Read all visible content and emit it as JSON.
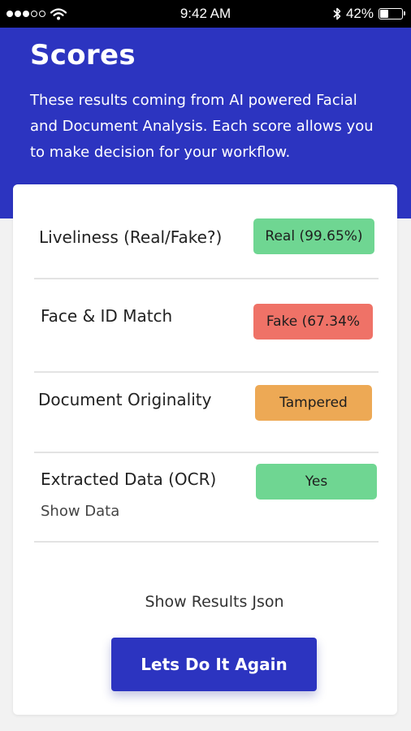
{
  "status_bar": {
    "time": "9:42 AM",
    "battery_text": "42%",
    "battery_level": 0.42,
    "signal_bars_filled": 3,
    "signal_bars_total": 5,
    "icons": [
      "signal-dots-icon",
      "wifi-icon",
      "bluetooth-icon",
      "battery-icon"
    ]
  },
  "header": {
    "title": "Scores",
    "description": "These results coming from AI powered Facial and Document Analysis. Each score allows you to make decision for your workflow."
  },
  "scores": [
    {
      "label": "Liveliness (Real/Fake?)",
      "badge": "Real (99.65%)",
      "status": "pass"
    },
    {
      "label": "Face & ID Match",
      "badge": "Fake (67.34%",
      "status": "fail"
    },
    {
      "label": "Document Originality",
      "badge": "Tampered",
      "status": "warn"
    },
    {
      "label": "Extracted Data (OCR)",
      "badge": "Yes",
      "status": "pass",
      "link": "Show Data"
    }
  ],
  "actions": {
    "show_results_json": "Show Results Json",
    "again_button": "Lets Do It Again"
  },
  "colors": {
    "brand": "#2c34c0",
    "pass": "#6fd692",
    "fail": "#ef7267",
    "warn": "#eda955",
    "background": "#f2f2f2"
  }
}
